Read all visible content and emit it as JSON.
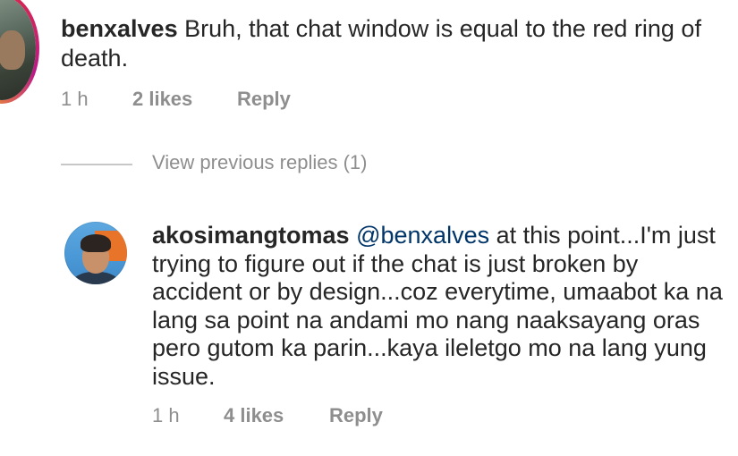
{
  "comment": {
    "username": "benxalves",
    "text": "Bruh, that chat window is equal to the red ring of death.",
    "time": "1 h",
    "likes": "2 likes",
    "reply": "Reply"
  },
  "view_previous": {
    "label": "View previous replies (1)"
  },
  "reply_comment": {
    "username": "akosimangtomas",
    "mention": "@benxalves",
    "text": "at this point...I'm just trying to figure out if the chat is just broken by accident or by design...coz everytime, umaabot ka na lang sa point na andami mo nang naaksayang oras pero gutom ka parin...kaya ileletgo mo na lang yung issue.",
    "time": "1 h",
    "likes": "4 likes",
    "reply": "Reply"
  },
  "colors": {
    "text": "#262626",
    "meta": "#8e8e8e",
    "mention": "#003569",
    "story_ring": "#dc2743"
  }
}
